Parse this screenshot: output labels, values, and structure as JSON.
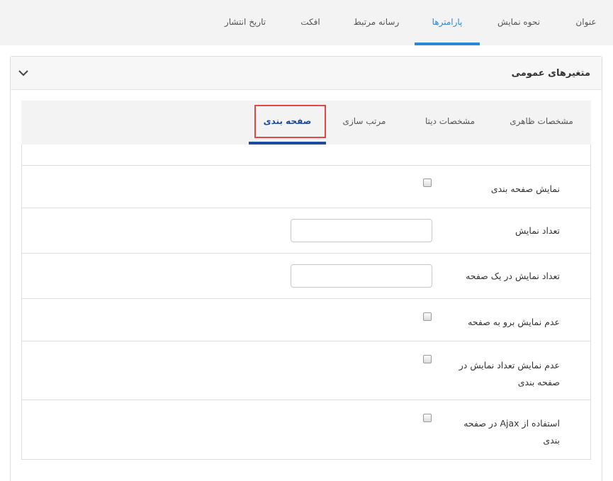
{
  "top_tabs": [
    {
      "label": "عنوان"
    },
    {
      "label": "نحوه نمایش"
    },
    {
      "label": "پارامترها"
    },
    {
      "label": "رسانه مرتبط"
    },
    {
      "label": "افکت"
    },
    {
      "label": "تاریخ انتشار"
    }
  ],
  "top_tabs_active_index": 2,
  "panel": {
    "title": "متغیرهای عمومی",
    "collapse_icon": "chevron-down-icon"
  },
  "inner_tabs": [
    {
      "label": "مشخصات ظاهری"
    },
    {
      "label": "مشخصات دیتا"
    },
    {
      "label": "مرتب سازی"
    },
    {
      "label": "صفحه بندی"
    }
  ],
  "inner_tabs_active_index": 3,
  "settings": [
    {
      "label": "نمایش صفحه بندی",
      "control": "checkbox",
      "checked": false
    },
    {
      "label": "تعداد نمایش",
      "control": "text",
      "value": ""
    },
    {
      "label": "تعداد نمایش در یک صفحه",
      "control": "text",
      "value": ""
    },
    {
      "label": "عدم نمایش برو به صفحه",
      "control": "checkbox",
      "checked": false
    },
    {
      "label": "عدم نمایش تعداد نمایش در صفحه بندی",
      "control": "checkbox",
      "checked": false
    },
    {
      "label": "استفاده از Ajax در صفحه بندی",
      "control": "checkbox",
      "checked": false
    }
  ],
  "colors": {
    "active_top_tab": "#2b88d8",
    "active_inner_tab": "#1f4b9c",
    "highlight": "#e04848"
  }
}
